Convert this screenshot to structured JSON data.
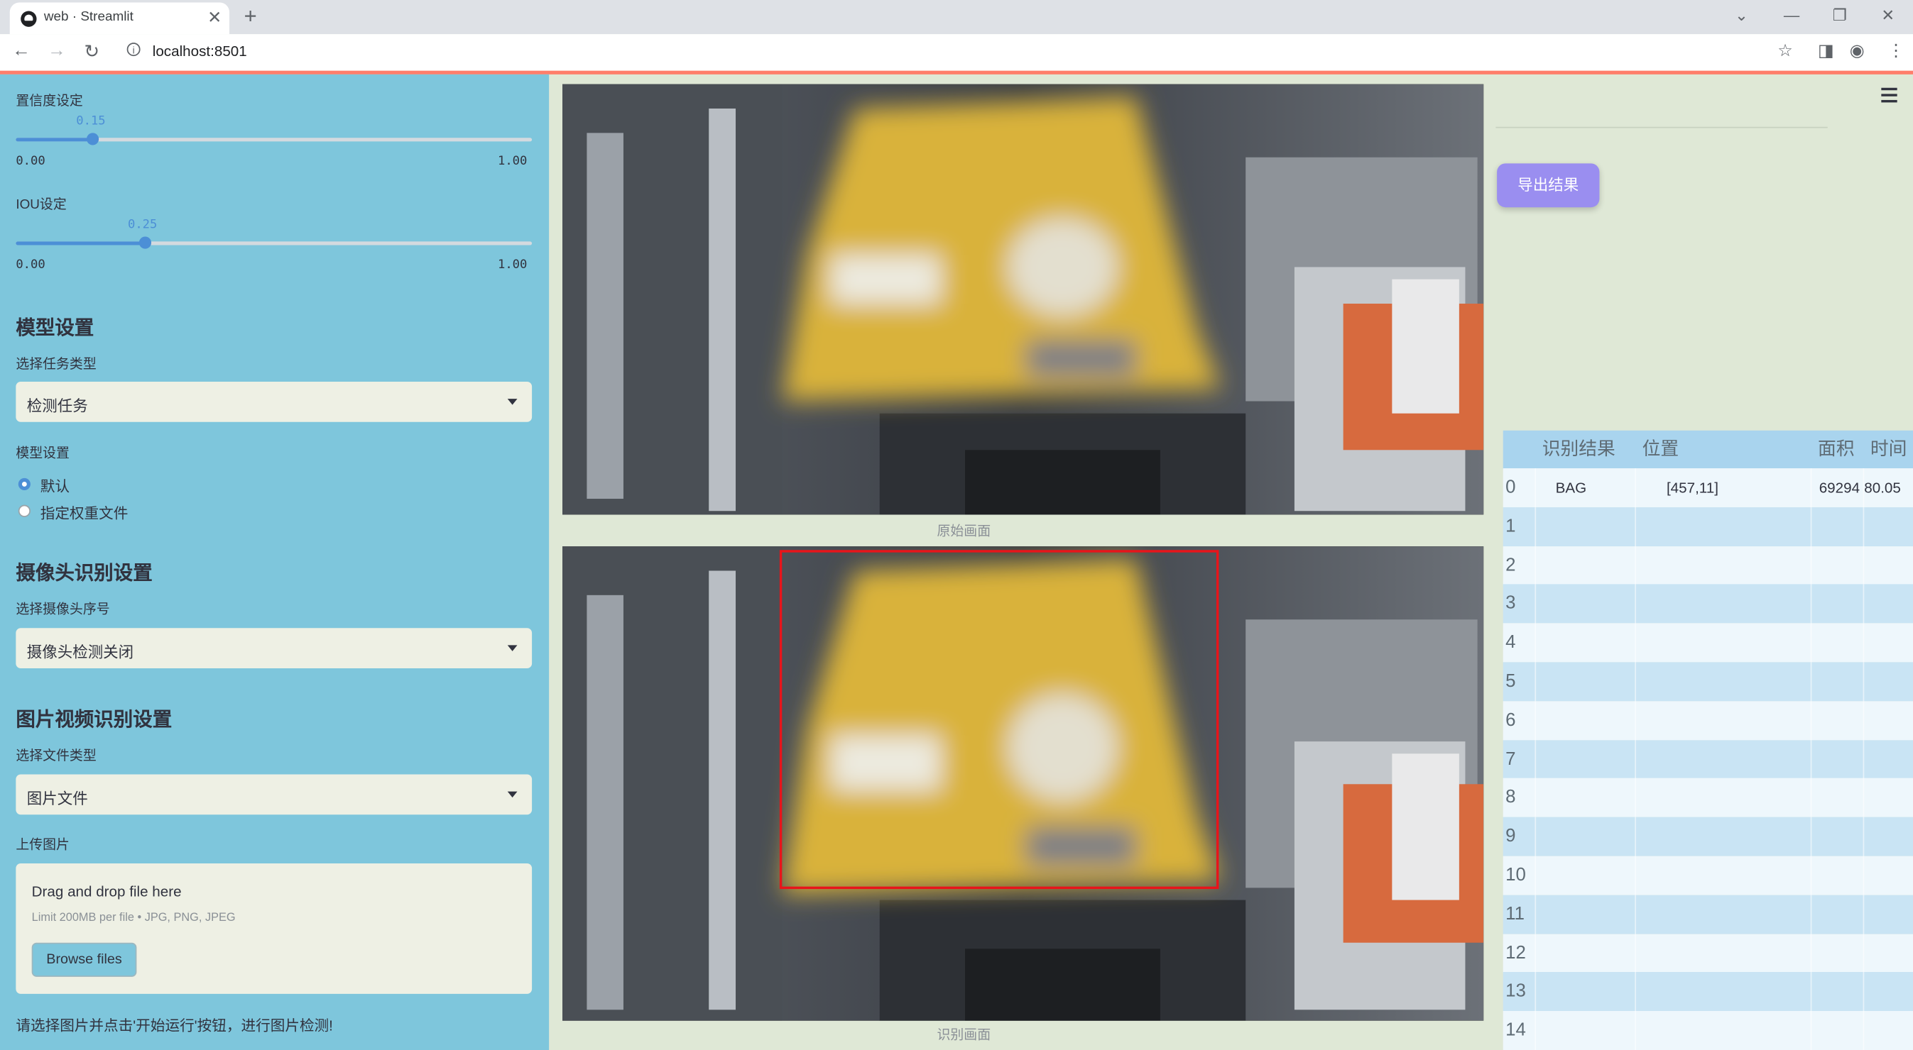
{
  "browser": {
    "tab_title": "web · Streamlit",
    "url": "localhost:8501"
  },
  "sidebar": {
    "conf": {
      "label": "置信度设定",
      "value": "0.15",
      "min": "0.00",
      "max": "1.00",
      "fraction": 0.15
    },
    "iou": {
      "label": "IOU设定",
      "value": "0.25",
      "min": "0.00",
      "max": "1.00",
      "fraction": 0.25
    },
    "model_section": {
      "title": "模型设置",
      "task_label": "选择任务类型",
      "task_value": "检测任务",
      "model_label": "模型设置",
      "options": [
        "默认",
        "指定权重文件"
      ],
      "selected_index": 0
    },
    "camera_section": {
      "title": "摄像头识别设置",
      "camera_label": "选择摄像头序号",
      "camera_value": "摄像头检测关闭"
    },
    "media_section": {
      "title": "图片视频识别设置",
      "file_type_label": "选择文件类型",
      "file_type_value": "图片文件",
      "upload_label": "上传图片",
      "drop_text": "Drag and drop file here",
      "limit_text": "Limit 200MB per file • JPG, PNG, JPEG",
      "browse_label": "Browse files"
    },
    "hint": "请选择图片并点击'开始运行'按钮，进行图片检测!"
  },
  "main": {
    "original_caption": "原始画面",
    "detected_caption": "识别画面",
    "export_label": "导出结果"
  },
  "table": {
    "headers": [
      "",
      "识别结果",
      "位置",
      "面积",
      "时间"
    ],
    "rows": [
      {
        "index": "0",
        "result": "BAG",
        "position": "[457,11]",
        "area": "69294",
        "time": "80.05"
      },
      {
        "index": "1",
        "result": "",
        "position": "",
        "area": "",
        "time": ""
      },
      {
        "index": "2",
        "result": "",
        "position": "",
        "area": "",
        "time": ""
      },
      {
        "index": "3",
        "result": "",
        "position": "",
        "area": "",
        "time": ""
      },
      {
        "index": "4",
        "result": "",
        "position": "",
        "area": "",
        "time": ""
      },
      {
        "index": "5",
        "result": "",
        "position": "",
        "area": "",
        "time": ""
      },
      {
        "index": "6",
        "result": "",
        "position": "",
        "area": "",
        "time": ""
      },
      {
        "index": "7",
        "result": "",
        "position": "",
        "area": "",
        "time": ""
      },
      {
        "index": "8",
        "result": "",
        "position": "",
        "area": "",
        "time": ""
      },
      {
        "index": "9",
        "result": "",
        "position": "",
        "area": "",
        "time": ""
      },
      {
        "index": "10",
        "result": "",
        "position": "",
        "area": "",
        "time": ""
      },
      {
        "index": "11",
        "result": "",
        "position": "",
        "area": "",
        "time": ""
      },
      {
        "index": "12",
        "result": "",
        "position": "",
        "area": "",
        "time": ""
      },
      {
        "index": "13",
        "result": "",
        "position": "",
        "area": "",
        "time": ""
      },
      {
        "index": "14",
        "result": "",
        "position": "",
        "area": "",
        "time": ""
      }
    ]
  },
  "colors": {
    "sidebar_bg": "#7ec6dc",
    "main_bg": "#dfe8d6",
    "slider_accent": "#4c8fd6",
    "export_button": "#9a8ef0",
    "detection_box": "#e8141a",
    "table_header": "#a9d4ee"
  }
}
